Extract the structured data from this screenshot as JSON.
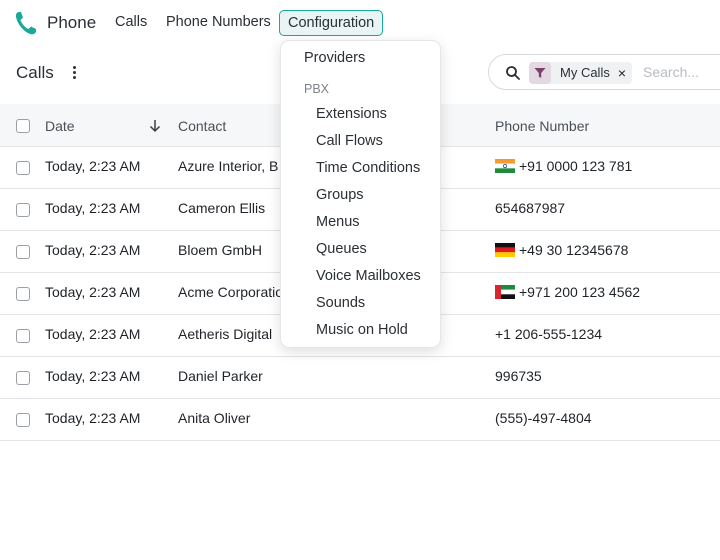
{
  "app": {
    "name": "Phone",
    "logo_icon": "phone-icon",
    "accent": "#1aa89a"
  },
  "nav": {
    "calls": "Calls",
    "phone_numbers": "Phone Numbers",
    "configuration": "Configuration"
  },
  "page": {
    "title": "Calls",
    "more_icon": "kebab-vertical-icon"
  },
  "search": {
    "chip_label": "My Calls",
    "chip_close": "×",
    "placeholder": "Search..."
  },
  "table": {
    "headers": {
      "date": "Date",
      "contact": "Contact",
      "phone": "Phone Number"
    },
    "rows": [
      {
        "date": "Today, 2:23 AM",
        "contact": "Azure Interior, B",
        "phone": "+91 0000 123 781",
        "flag": "IN"
      },
      {
        "date": "Today, 2:23 AM",
        "contact": "Cameron Ellis",
        "phone": "654687987",
        "flag": ""
      },
      {
        "date": "Today, 2:23 AM",
        "contact": "Bloem GmbH",
        "phone": "+49 30 12345678",
        "flag": "DE"
      },
      {
        "date": "Today, 2:23 AM",
        "contact": "Acme Corporatio",
        "phone": "+971 200 123 4562",
        "flag": "AE"
      },
      {
        "date": "Today, 2:23 AM",
        "contact": "Aetheris Digital",
        "phone": "+1 206-555-1234",
        "flag": ""
      },
      {
        "date": "Today, 2:23 AM",
        "contact": "Daniel Parker",
        "phone": "996735",
        "flag": ""
      },
      {
        "date": "Today, 2:23 AM",
        "contact": "Anita Oliver",
        "phone": "(555)-497-4804",
        "flag": ""
      }
    ]
  },
  "dropdown": {
    "providers": "Providers",
    "group_label": "PBX",
    "items": [
      "Extensions",
      "Call Flows",
      "Time Conditions",
      "Groups",
      "Menus",
      "Queues",
      "Voice Mailboxes",
      "Sounds",
      "Music on Hold"
    ]
  }
}
